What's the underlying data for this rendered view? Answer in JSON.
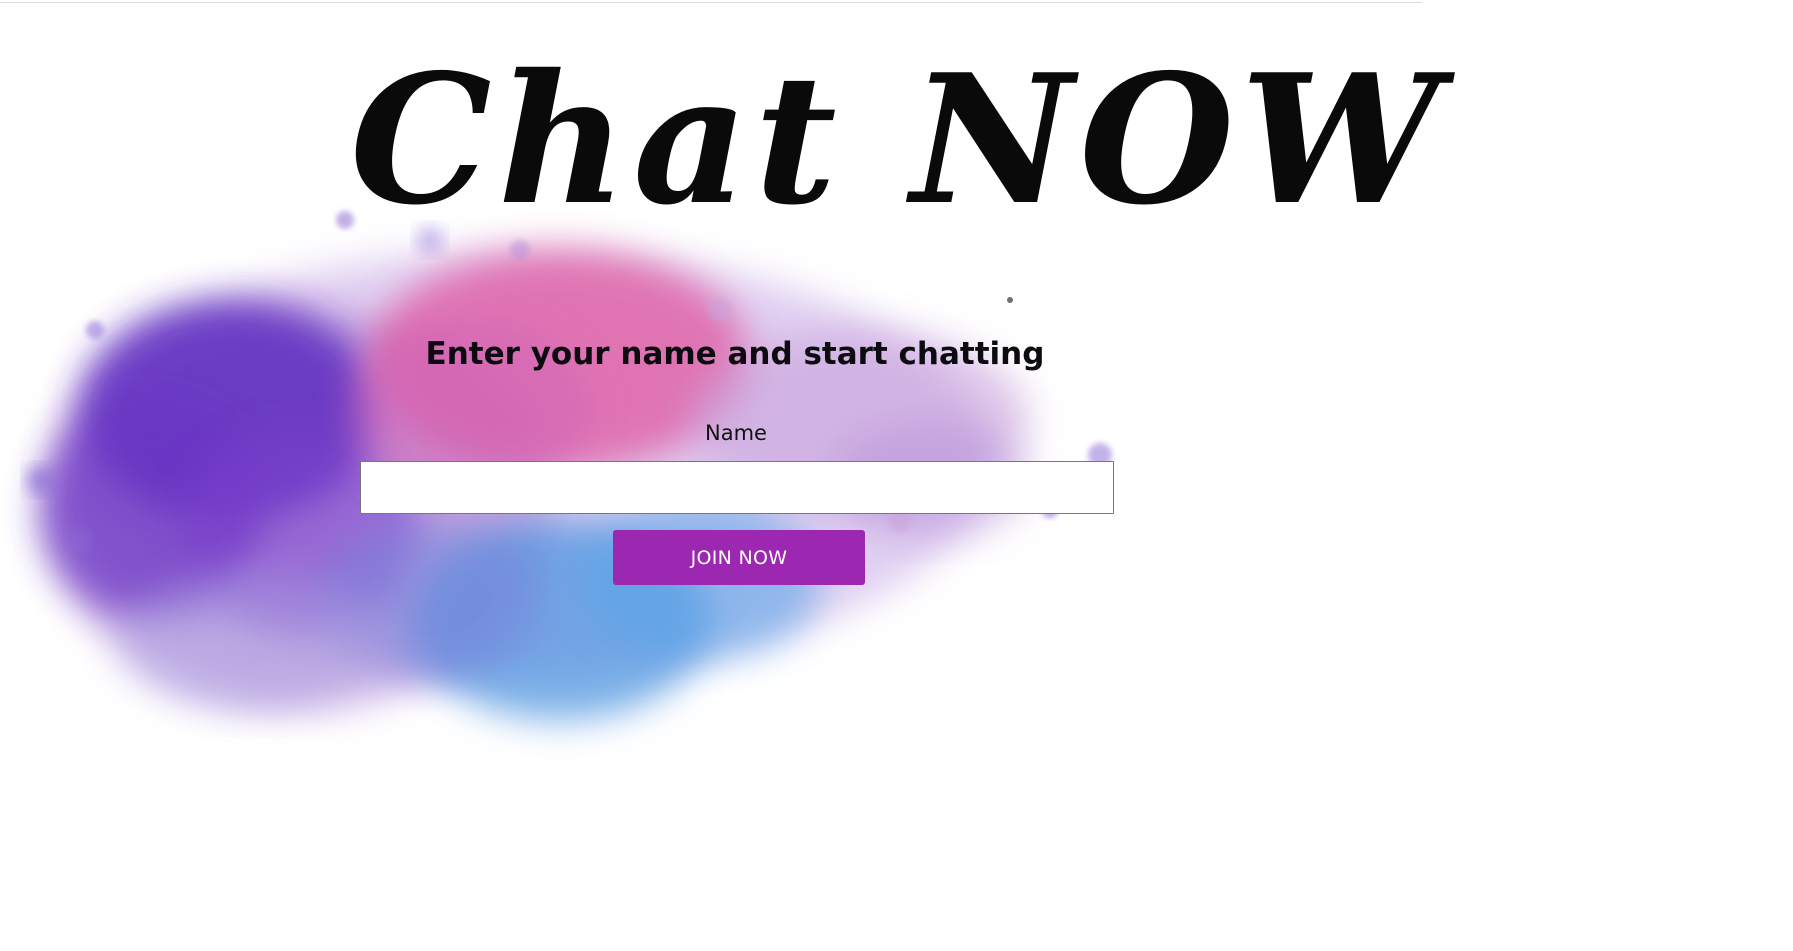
{
  "logo": {
    "text": "Chat NOW"
  },
  "form": {
    "heading": "Enter your name and start chatting",
    "name_label": "Name",
    "name_value": "",
    "join_label": "JOIN NOW"
  },
  "colors": {
    "button": "#9c27b0",
    "button_text": "#ffffff",
    "splash_violet": "#6a35c4",
    "splash_pink": "#e0579e",
    "splash_blue": "#4f95e0",
    "splash_lavender": "#b58fd8"
  },
  "icons": {
    "background": "watercolor-splash"
  }
}
